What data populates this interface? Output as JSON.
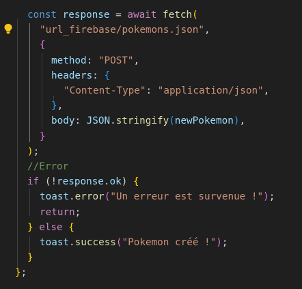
{
  "editor": {
    "lines": [
      [
        {
          "t": "const",
          "c": "keyword"
        },
        {
          "t": " ",
          "c": "punct"
        },
        {
          "t": "response",
          "c": "variable"
        },
        {
          "t": " = ",
          "c": "op"
        },
        {
          "t": "await",
          "c": "control"
        },
        {
          "t": " ",
          "c": "punct"
        },
        {
          "t": "fetch",
          "c": "function"
        },
        {
          "t": "(",
          "c": "brace1"
        }
      ],
      [
        {
          "t": "\"url_firebase/pokemons.json\"",
          "c": "string"
        },
        {
          "t": ",",
          "c": "punct"
        }
      ],
      [
        {
          "t": "{",
          "c": "brace2"
        }
      ],
      [
        {
          "t": "method",
          "c": "property"
        },
        {
          "t": ": ",
          "c": "punct"
        },
        {
          "t": "\"POST\"",
          "c": "string"
        },
        {
          "t": ",",
          "c": "punct"
        }
      ],
      [
        {
          "t": "headers",
          "c": "property"
        },
        {
          "t": ": ",
          "c": "punct"
        },
        {
          "t": "{",
          "c": "brace3"
        }
      ],
      [
        {
          "t": "\"Content-Type\"",
          "c": "string"
        },
        {
          "t": ": ",
          "c": "punct"
        },
        {
          "t": "\"application/json\"",
          "c": "string"
        },
        {
          "t": ",",
          "c": "punct"
        }
      ],
      [
        {
          "t": "}",
          "c": "brace3"
        },
        {
          "t": ",",
          "c": "punct"
        }
      ],
      [
        {
          "t": "body",
          "c": "property"
        },
        {
          "t": ": ",
          "c": "punct"
        },
        {
          "t": "JSON",
          "c": "variable"
        },
        {
          "t": ".",
          "c": "punct"
        },
        {
          "t": "stringify",
          "c": "function"
        },
        {
          "t": "(",
          "c": "brace3"
        },
        {
          "t": "newPokemon",
          "c": "variable"
        },
        {
          "t": ")",
          "c": "brace3"
        },
        {
          "t": ",",
          "c": "punct"
        }
      ],
      [
        {
          "t": "}",
          "c": "brace2"
        }
      ],
      [
        {
          "t": ")",
          "c": "brace1"
        },
        {
          "t": ";",
          "c": "punct"
        }
      ],
      [
        {
          "t": "//Error",
          "c": "comment"
        }
      ],
      [
        {
          "t": "if",
          "c": "control"
        },
        {
          "t": " (",
          "c": "punct"
        },
        {
          "t": "!",
          "c": "op"
        },
        {
          "t": "response",
          "c": "variable"
        },
        {
          "t": ".",
          "c": "punct"
        },
        {
          "t": "ok",
          "c": "variable"
        },
        {
          "t": ") ",
          "c": "punct"
        },
        {
          "t": "{",
          "c": "brace1"
        }
      ],
      [
        {
          "t": "toast",
          "c": "variable"
        },
        {
          "t": ".",
          "c": "punct"
        },
        {
          "t": "error",
          "c": "function"
        },
        {
          "t": "(",
          "c": "brace2"
        },
        {
          "t": "\"Un erreur est survenue !\"",
          "c": "string"
        },
        {
          "t": ")",
          "c": "brace2"
        },
        {
          "t": ";",
          "c": "punct"
        }
      ],
      [
        {
          "t": "return",
          "c": "control"
        },
        {
          "t": ";",
          "c": "punct"
        }
      ],
      [
        {
          "t": "}",
          "c": "brace1"
        },
        {
          "t": " ",
          "c": "punct"
        },
        {
          "t": "else",
          "c": "control"
        },
        {
          "t": " ",
          "c": "punct"
        },
        {
          "t": "{",
          "c": "brace1"
        }
      ],
      [
        {
          "t": "toast",
          "c": "variable"
        },
        {
          "t": ".",
          "c": "punct"
        },
        {
          "t": "success",
          "c": "function"
        },
        {
          "t": "(",
          "c": "brace2"
        },
        {
          "t": "\"Pokemon créé !\"",
          "c": "string"
        },
        {
          "t": ")",
          "c": "brace2"
        },
        {
          "t": ";",
          "c": "punct"
        }
      ],
      [
        {
          "t": "}",
          "c": "brace1"
        }
      ],
      [
        {
          "t": "}",
          "c": "brace1"
        },
        {
          "t": ";",
          "c": "punct"
        }
      ]
    ],
    "gutter_icon": "lightbulb-icon"
  }
}
